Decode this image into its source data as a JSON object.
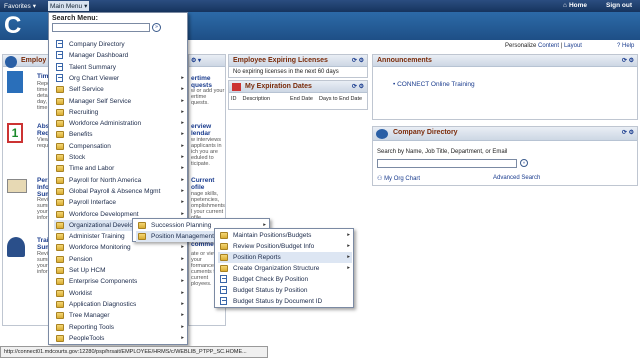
{
  "topbar": {
    "favorites": "Favorites",
    "main_menu": "Main Menu",
    "home": "Home",
    "sign_out": "Sign out"
  },
  "header": {
    "logo": "C"
  },
  "personalize": {
    "prefix": "Personalize",
    "content": "Content",
    "sep": "|",
    "layout": "Layout"
  },
  "help": "Help",
  "left_pagelets": [
    {
      "title": "Employ",
      "desc": ""
    },
    {
      "title": "Time",
      "desc": "Repo... time a detail day, w time p"
    },
    {
      "title": "Abs Requ",
      "desc": "View requ"
    },
    {
      "title": "Pers Info Sum",
      "desc": "Revie summ your inform"
    },
    {
      "title": "Trai Sum",
      "desc": "Revie summ your inform"
    }
  ],
  "middle_frag": [
    {
      "title": "ertime quests",
      "desc": "w or add your ertime quests."
    },
    {
      "title": "erview lendar",
      "desc": "w interviews applicants in ich you are eduled to ticipate."
    },
    {
      "title": "Current ofile",
      "desc": "nage skills, npetencies, omplishments l your current ofile."
    },
    {
      "title": "comme",
      "desc": "ate or view your formance cuments for current ployees."
    }
  ],
  "expiring": {
    "title": "Employee Expiring Licenses",
    "text": "No expiring licenses in the next 60 days"
  },
  "my_exp": {
    "title": "My Expiration Dates",
    "cols": [
      "ID",
      "Description",
      "End Date",
      "Days to End Date"
    ]
  },
  "announcements": {
    "title": "Announcements",
    "item": "CONNECT Online Training"
  },
  "directory": {
    "title": "Company Directory",
    "search_label": "Search by Name, Job Title, Department, or Email",
    "my_org": "My Org Chart",
    "advanced": "Advanced Search"
  },
  "main_menu": {
    "title": "Search Menu:",
    "items": [
      {
        "label": "Company Directory",
        "icon": "doc",
        "arrow": false
      },
      {
        "label": "Manager Dashboard",
        "icon": "doc",
        "arrow": false
      },
      {
        "label": "Talent Summary",
        "icon": "doc",
        "arrow": false
      },
      {
        "label": "Org Chart Viewer",
        "icon": "doc",
        "arrow": true
      },
      {
        "label": "Self Service",
        "icon": "folder",
        "arrow": true
      },
      {
        "label": "Manager Self Service",
        "icon": "folder",
        "arrow": true
      },
      {
        "label": "Recruiting",
        "icon": "folder",
        "arrow": true
      },
      {
        "label": "Workforce Administration",
        "icon": "folder",
        "arrow": true
      },
      {
        "label": "Benefits",
        "icon": "folder",
        "arrow": true
      },
      {
        "label": "Compensation",
        "icon": "folder",
        "arrow": true
      },
      {
        "label": "Stock",
        "icon": "folder",
        "arrow": true
      },
      {
        "label": "Time and Labor",
        "icon": "folder",
        "arrow": true
      },
      {
        "label": "Payroll for North America",
        "icon": "folder",
        "arrow": true
      },
      {
        "label": "Global Payroll & Absence Mgmt",
        "icon": "folder",
        "arrow": true
      },
      {
        "label": "Payroll Interface",
        "icon": "folder",
        "arrow": true
      },
      {
        "label": "Workforce Development",
        "icon": "folder",
        "arrow": true
      },
      {
        "label": "Organizational Develop",
        "icon": "folder",
        "arrow": true
      },
      {
        "label": "Administer Training",
        "icon": "folder",
        "arrow": true
      },
      {
        "label": "Workforce Monitoring",
        "icon": "folder",
        "arrow": true
      },
      {
        "label": "Pension",
        "icon": "folder",
        "arrow": true
      },
      {
        "label": "Set Up HCM",
        "icon": "folder",
        "arrow": true
      },
      {
        "label": "Enterprise Components",
        "icon": "folder",
        "arrow": true
      },
      {
        "label": "Worklist",
        "icon": "folder",
        "arrow": true
      },
      {
        "label": "Application Diagnostics",
        "icon": "folder",
        "arrow": true
      },
      {
        "label": "Tree Manager",
        "icon": "folder",
        "arrow": true
      },
      {
        "label": "Reporting Tools",
        "icon": "folder",
        "arrow": true
      },
      {
        "label": "PeopleTools",
        "icon": "folder",
        "arrow": true
      }
    ]
  },
  "submenu1": [
    {
      "label": "Succession Planning",
      "arrow": true
    },
    {
      "label": "Position Management",
      "arrow": true
    }
  ],
  "submenu2": [
    {
      "label": "Maintain Positions/Budgets",
      "icon": "folder",
      "arrow": true
    },
    {
      "label": "Review Position/Budget Info",
      "icon": "folder",
      "arrow": true
    },
    {
      "label": "Position Reports",
      "icon": "folder",
      "arrow": true
    },
    {
      "label": "Create Organization Structure",
      "icon": "folder",
      "arrow": true
    },
    {
      "label": "Budget Check By Position",
      "icon": "doc",
      "arrow": false
    },
    {
      "label": "Budget Status by Position",
      "icon": "doc",
      "arrow": false
    },
    {
      "label": "Budget Status by Document ID",
      "icon": "doc",
      "arrow": false
    }
  ],
  "statusbar": "http://connect01.mdcourts.gov:12280/psp/hrsait/EMPLOYEE/HRMS/c/WEBLIB_PTPP_SC.HOME..."
}
